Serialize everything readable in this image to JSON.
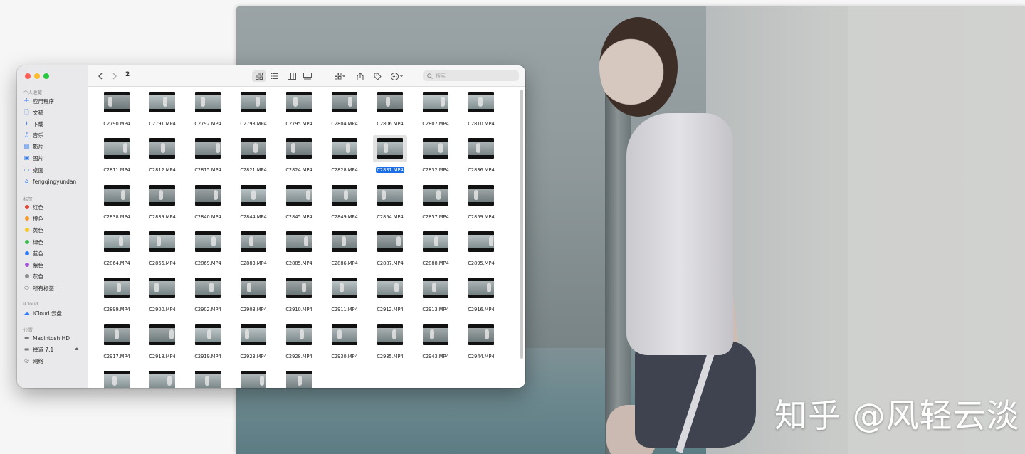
{
  "watermark": "知乎 @风轻云淡",
  "finder": {
    "path_title": "2",
    "search": {
      "placeholder": "搜索"
    },
    "sidebar": {
      "favorites_title": "个人收藏",
      "favorites": [
        {
          "label": "应用程序",
          "icon": "applications-icon"
        },
        {
          "label": "文稿",
          "icon": "document-icon"
        },
        {
          "label": "下载",
          "icon": "download-icon"
        },
        {
          "label": "音乐",
          "icon": "music-icon"
        },
        {
          "label": "影片",
          "icon": "movies-icon"
        },
        {
          "label": "图片",
          "icon": "pictures-icon"
        },
        {
          "label": "桌面",
          "icon": "desktop-icon"
        },
        {
          "label": "fengqingyundan",
          "icon": "home-icon"
        }
      ],
      "tags_title": "标签",
      "tags": [
        {
          "label": "红色",
          "color": "#e5453d"
        },
        {
          "label": "橙色",
          "color": "#f39a2b"
        },
        {
          "label": "黄色",
          "color": "#f5c824"
        },
        {
          "label": "绿色",
          "color": "#3fbf4f"
        },
        {
          "label": "蓝色",
          "color": "#2f7bf6"
        },
        {
          "label": "紫色",
          "color": "#a357d6"
        },
        {
          "label": "灰色",
          "color": "#8e8e92"
        },
        {
          "label": "所有标签…",
          "color": ""
        }
      ],
      "icloud_title": "iCloud",
      "icloud": [
        {
          "label": "iCloud 云盘",
          "icon": "cloud-icon"
        }
      ],
      "locations_title": "位置",
      "locations": [
        {
          "label": "Macintosh HD",
          "icon": "disk-icon"
        },
        {
          "label": "禅道 7.1",
          "icon": "disk-icon"
        },
        {
          "label": "网络",
          "icon": "network-icon"
        }
      ]
    },
    "selected_file": "C2831.MP4",
    "files": [
      "C2790.MP4",
      "C2791.MP4",
      "C2792.MP4",
      "C2793.MP4",
      "C2795.MP4",
      "C2804.MP4",
      "C2806.MP4",
      "C2807.MP4",
      "C2810.MP4",
      "C2811.MP4",
      "C2812.MP4",
      "C2815.MP4",
      "C2821.MP4",
      "C2824.MP4",
      "C2828.MP4",
      "C2831.MP4",
      "C2832.MP4",
      "C2836.MP4",
      "C2838.MP4",
      "C2839.MP4",
      "C2840.MP4",
      "C2844.MP4",
      "C2845.MP4",
      "C2849.MP4",
      "C2854.MP4",
      "C2857.MP4",
      "C2859.MP4",
      "C2864.MP4",
      "C2866.MP4",
      "C2869.MP4",
      "C2883.MP4",
      "C2885.MP4",
      "C2886.MP4",
      "C2887.MP4",
      "C2888.MP4",
      "C2895.MP4",
      "C2899.MP4",
      "C2900.MP4",
      "C2902.MP4",
      "C2903.MP4",
      "C2910.MP4",
      "C2911.MP4",
      "C2912.MP4",
      "C2913.MP4",
      "C2916.MP4",
      "C2917.MP4",
      "C2918.MP4",
      "C2919.MP4",
      "C2923.MP4",
      "C2928.MP4",
      "C2930.MP4",
      "C2935.MP4",
      "C2943.MP4",
      "C2944.MP4",
      "",
      "",
      "",
      "",
      ""
    ]
  }
}
